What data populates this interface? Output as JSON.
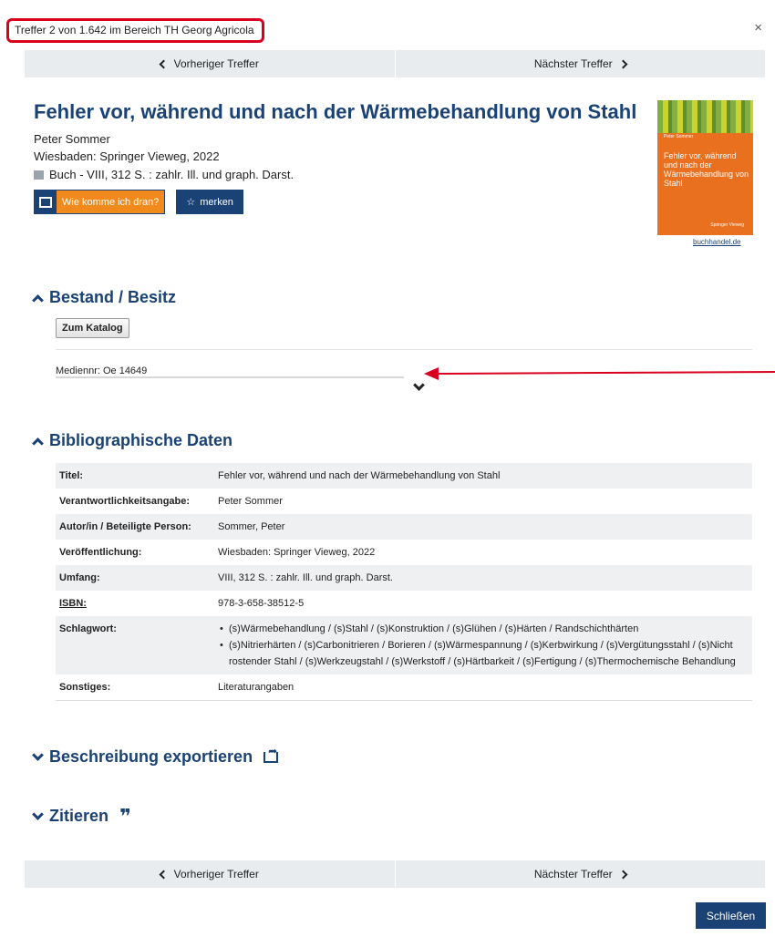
{
  "header": {
    "hit_counter": "Treffer 2 von 1.642 im Bereich TH Georg Agricola",
    "close_symbol": "×"
  },
  "pager": {
    "previous_label": "Vorheriger Treffer",
    "next_label": "Nächster Treffer"
  },
  "record": {
    "title": "Fehler vor, während und nach der Wärmebehandlung von Stahl",
    "author": "Peter Sommer",
    "published": "Wiesbaden: Springer Vieweg, 2022",
    "format": "Buch - VIII, 312 S. : zahlr. Ill. und graph. Darst.",
    "format_icon": "book-icon",
    "availability_button": "Wie komme ich dran?",
    "save_button": "merken",
    "save_icon": "star-outline-icon"
  },
  "cover": {
    "author": "Peter Sommer",
    "title": "Fehler vor, während und nach der Wärmebehandlung von Stahl",
    "publisher": "Springer Vieweg",
    "source_link": "buchhandel.de"
  },
  "holdings": {
    "heading": "Bestand / Besitz",
    "catalog_button": "Zum Katalog",
    "media_number": "Mediennr: Oe 14649"
  },
  "biblio": {
    "heading": "Bibliographische Daten",
    "rows": [
      {
        "label": "Titel:",
        "value": "Fehler vor, während und nach der Wärmebehandlung von Stahl"
      },
      {
        "label": "Verantwortlichkeitsangabe:",
        "value": "Peter Sommer"
      },
      {
        "label": "Autor/in / Beteiligte Person:",
        "value": "Sommer, Peter"
      },
      {
        "label": "Veröffentlichung:",
        "value": "Wiesbaden: Springer Vieweg, 2022"
      },
      {
        "label": "Umfang:",
        "value": "VIII, 312 S. : zahlr. Ill. und graph. Darst."
      },
      {
        "label": "ISBN:",
        "value": "978-3-658-38512-5"
      },
      {
        "label": "Schlagwort:",
        "subjects": [
          "(s)Wärmebehandlung / (s)Stahl / (s)Konstruktion / (s)Glühen / (s)Härten / Randschichthärten",
          "(s)Nitrierhärten / (s)Carbonitrieren / Borieren / (s)Wärmespannung / (s)Kerbwirkung / (s)Vergütungsstahl / (s)Nicht rostender Stahl / (s)Werkzeugstahl / (s)Werkstoff / (s)Härtbarkeit / (s)Fertigung / (s)Thermochemische Behandlung"
        ]
      },
      {
        "label": "Sonstiges:",
        "value": "Literaturangaben"
      }
    ]
  },
  "export": {
    "heading": "Beschreibung exportieren",
    "icon": "share-icon"
  },
  "cite": {
    "heading": "Zitieren",
    "icon": "quote-icon"
  },
  "footer": {
    "close_button": "Schließen"
  },
  "colors": {
    "brand": "#1a4275",
    "accent_orange": "#f08a1c",
    "highlight_red": "#d8001e",
    "pager_bg": "#e9ecef"
  }
}
